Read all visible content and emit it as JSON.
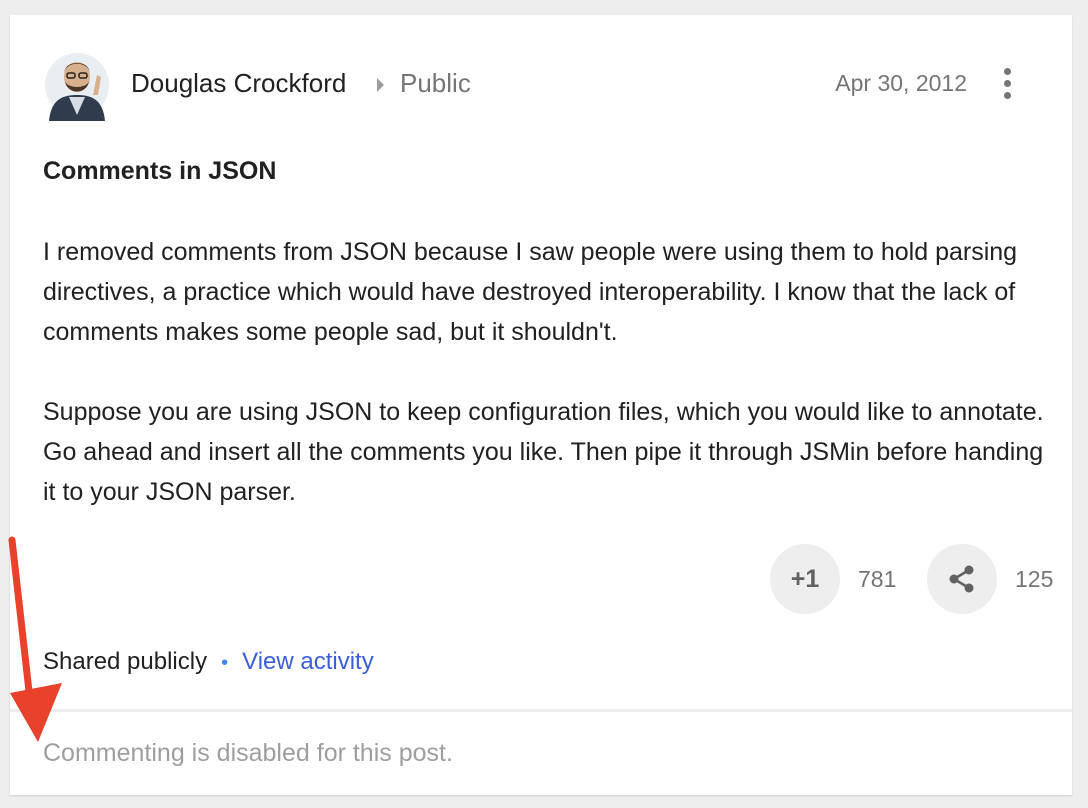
{
  "post": {
    "author": "Douglas Crockford",
    "audience": "Public",
    "date": "Apr 30, 2012",
    "title": "Comments in JSON",
    "paragraphs": [
      "I removed comments from JSON because I saw people were using them to hold parsing directives, a practice which would have destroyed interoperability.  I know that the lack of comments makes some people sad, but it shouldn't.",
      "Suppose you are using JSON to keep configuration files, which you would like to annotate. Go ahead and insert all the comments you like. Then pipe it through JSMin before handing it to your JSON parser."
    ]
  },
  "actions": {
    "plus_one_label": "+1",
    "plus_one_count": "781",
    "share_count": "125"
  },
  "footer": {
    "shared_text": "Shared publicly",
    "separator": "•",
    "view_activity": "View activity",
    "comment_notice": "Commenting is disabled for this post."
  },
  "colors": {
    "arrow": "#e8412c",
    "link": "#3b5fd9"
  }
}
